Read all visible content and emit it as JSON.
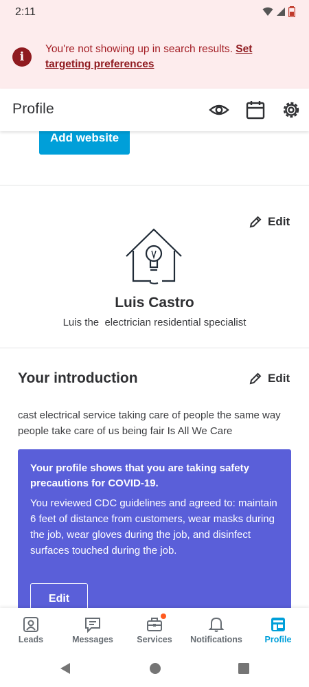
{
  "status_bar": {
    "time": "2:11"
  },
  "alert": {
    "message": "You're not showing up in search results. ",
    "link_label": "Set targeting preferences"
  },
  "header": {
    "title": "Profile",
    "icons": [
      "eye-icon",
      "calendar-icon",
      "gear-icon"
    ]
  },
  "website": {
    "button_label": "Add website"
  },
  "profile": {
    "edit_label": "Edit",
    "name": "Luis Castro",
    "tagline": "Luis the  electrician residential specialist"
  },
  "introduction": {
    "title": "Your introduction",
    "edit_label": "Edit",
    "text": "cast electrical service taking care of people the same way people take care of us being fair Is All We Care"
  },
  "safety": {
    "heading": "Your profile shows that you are taking safety precautions for COVID-19.",
    "body": "You reviewed CDC guidelines and agreed to: maintain 6 feet of distance from customers, wear masks during the job, wear gloves during the job, and disinfect surfaces touched during the job.",
    "edit_label": "Edit"
  },
  "tabs": [
    {
      "label": "Leads",
      "icon": "person-badge-icon",
      "active": false
    },
    {
      "label": "Messages",
      "icon": "message-icon",
      "active": false
    },
    {
      "label": "Services",
      "icon": "briefcase-icon",
      "active": false,
      "badge": true
    },
    {
      "label": "Notifications",
      "icon": "bell-icon",
      "active": false
    },
    {
      "label": "Profile",
      "icon": "storefront-icon",
      "active": true
    }
  ],
  "colors": {
    "accent": "#009fd9",
    "alert_bg": "#fdeced",
    "alert_text": "#a31d24",
    "safety_card": "#5a5fd9",
    "badge": "#ff5a1f"
  }
}
